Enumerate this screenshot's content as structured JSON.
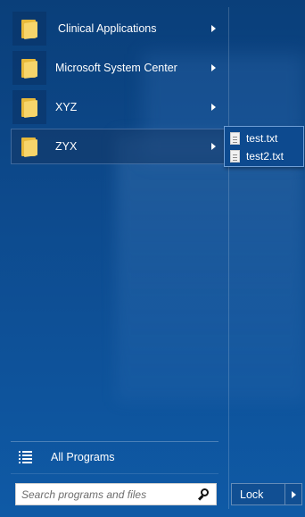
{
  "programs": {
    "folders": [
      {
        "label": "Clinical Applications",
        "icon": "folder-icon",
        "active": false
      },
      {
        "label": "Microsoft System Center",
        "icon": "folder-icon",
        "active": false
      },
      {
        "label": "XYZ",
        "icon": "folder-icon",
        "active": false
      },
      {
        "label": "ZYX",
        "icon": "folder-icon",
        "active": true
      }
    ],
    "flyout": {
      "files": [
        {
          "label": "test.txt",
          "icon": "text-file-icon"
        },
        {
          "label": "test2.txt",
          "icon": "text-file-icon"
        }
      ]
    },
    "all_programs": {
      "label": "All Programs",
      "icon": "list-icon"
    }
  },
  "search": {
    "placeholder": "Search programs and files",
    "value": "",
    "icon": "search-icon"
  },
  "power": {
    "label": "Lock",
    "arrow_icon": "chevron-right-icon"
  },
  "colors": {
    "background": "#0d4a8d",
    "folder_yellow": "#f7d56b",
    "flyout_border": "#6f9fd6"
  }
}
